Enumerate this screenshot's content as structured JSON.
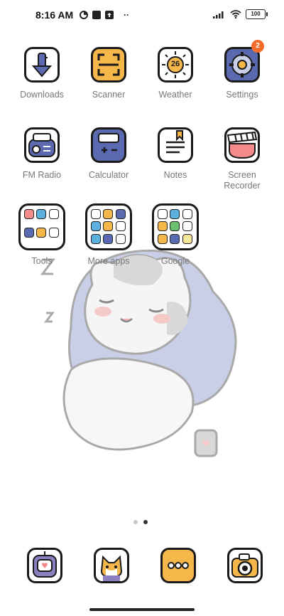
{
  "status_bar": {
    "time": "8:16 AM",
    "battery": "100",
    "more": "··"
  },
  "apps": [
    {
      "label": "Downloads",
      "icon": "download-icon"
    },
    {
      "label": "Scanner",
      "icon": "scanner-icon"
    },
    {
      "label": "Weather",
      "icon": "weather-icon",
      "value": "26"
    },
    {
      "label": "Settings",
      "icon": "gear-icon",
      "badge": "2"
    },
    {
      "label": "FM Radio",
      "icon": "radio-icon"
    },
    {
      "label": "Calculator",
      "icon": "calculator-icon"
    },
    {
      "label": "Notes",
      "icon": "notes-icon"
    },
    {
      "label": "Screen Recorder",
      "label_line1": "Screen",
      "label_line2": "Recorder",
      "icon": "screen-recorder-icon"
    }
  ],
  "folders": [
    {
      "label": "Tools"
    },
    {
      "label": "More apps"
    },
    {
      "label": "Google"
    }
  ],
  "dock": [
    {
      "icon": "messaging-robot-icon"
    },
    {
      "icon": "cat-contacts-icon"
    },
    {
      "icon": "more-dots-icon"
    },
    {
      "icon": "camera-icon"
    }
  ],
  "colors": {
    "accent_orange": "#f36c2a",
    "icon_blue": "#5b6ab0",
    "icon_yellow": "#f5b74a",
    "icon_pink": "#f58a8a"
  }
}
